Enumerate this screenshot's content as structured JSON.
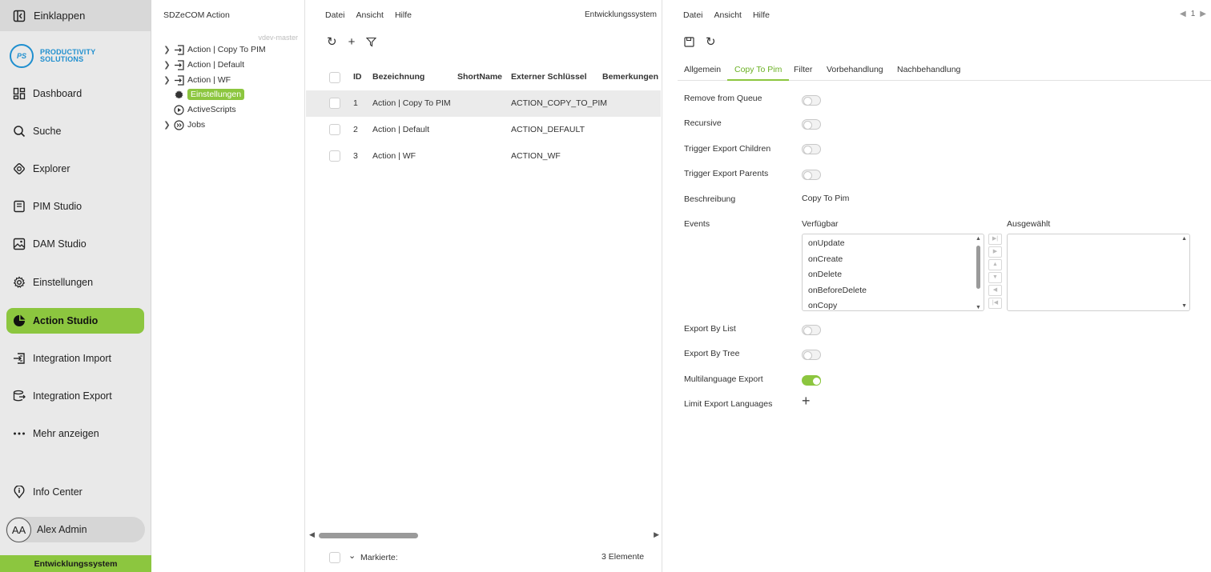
{
  "nav": {
    "collapse": "Einklappen",
    "logo": {
      "mark": "PS",
      "line1": "PRODUCTIVITY",
      "line2": "SOLUTIONS"
    },
    "items": [
      {
        "label": "Dashboard",
        "icon": "dashboard-icon"
      },
      {
        "label": "Suche",
        "icon": "search-icon"
      },
      {
        "label": "Explorer",
        "icon": "explorer-icon"
      },
      {
        "label": "PIM Studio",
        "icon": "pim-icon"
      },
      {
        "label": "DAM Studio",
        "icon": "image-icon"
      },
      {
        "label": "Einstellungen",
        "icon": "gear-icon"
      },
      {
        "label": "Action Studio",
        "icon": "action-icon",
        "active": true
      },
      {
        "label": "Integration Import",
        "icon": "import-icon"
      },
      {
        "label": "Integration Export",
        "icon": "export-icon"
      },
      {
        "label": "Mehr anzeigen",
        "icon": "more-icon"
      }
    ],
    "info_center": "Info Center",
    "user": {
      "initials": "AA",
      "name": "Alex Admin"
    },
    "footer": "Entwicklungssystem",
    "accent": "#8cc63f"
  },
  "tree": {
    "title": "SDZeCOM Action",
    "branch": "vdev-master",
    "items": [
      {
        "label": "Action | Copy To PIM"
      },
      {
        "label": "Action | Default"
      },
      {
        "label": "Action | WF"
      },
      {
        "label": "Einstellungen",
        "selected": true
      },
      {
        "label": "ActiveScripts"
      },
      {
        "label": "Jobs"
      }
    ]
  },
  "table": {
    "menu": [
      "Datei",
      "Ansicht",
      "Hilfe"
    ],
    "env": "Entwicklungssystem",
    "columns": [
      "ID",
      "Bezeichnung",
      "ShortName",
      "Externer Schlüssel",
      "Bemerkungen"
    ],
    "rows": [
      {
        "id": "1",
        "name": "Action | Copy To PIM",
        "short": "",
        "key": "ACTION_COPY_TO_PIM",
        "notes": ""
      },
      {
        "id": "2",
        "name": "Action | Default",
        "short": "",
        "key": "ACTION_DEFAULT",
        "notes": ""
      },
      {
        "id": "3",
        "name": "Action | WF",
        "short": "",
        "key": "ACTION_WF",
        "notes": ""
      }
    ],
    "footer": {
      "marked": "Markierte:",
      "count": "3 Elemente"
    }
  },
  "detail": {
    "menu": [
      "Datei",
      "Ansicht",
      "Hilfe"
    ],
    "pager": "1",
    "tabs": [
      "Allgemein",
      "Copy To Pim",
      "Filter",
      "Vorbehandlung",
      "Nachbehandlung"
    ],
    "active_tab": 1,
    "fields": {
      "remove_from_queue": {
        "label": "Remove from Queue",
        "on": false
      },
      "recursive": {
        "label": "Recursive",
        "on": false
      },
      "trigger_children": {
        "label": "Trigger Export Children",
        "on": false
      },
      "trigger_parents": {
        "label": "Trigger Export Parents",
        "on": false
      },
      "beschreibung": {
        "label": "Beschreibung",
        "value": "Copy To Pim"
      },
      "events": {
        "label": "Events",
        "available_label": "Verfügbar",
        "selected_label": "Ausgewählt",
        "available": [
          "onUpdate",
          "onCreate",
          "onDelete",
          "onBeforeDelete",
          "onCopy"
        ],
        "selected": []
      },
      "export_by_list": {
        "label": "Export By List",
        "on": false
      },
      "export_by_tree": {
        "label": "Export By Tree",
        "on": false
      },
      "multilanguage": {
        "label": "Multilanguage Export",
        "on": true
      },
      "limit_languages": {
        "label": "Limit Export Languages"
      }
    }
  }
}
